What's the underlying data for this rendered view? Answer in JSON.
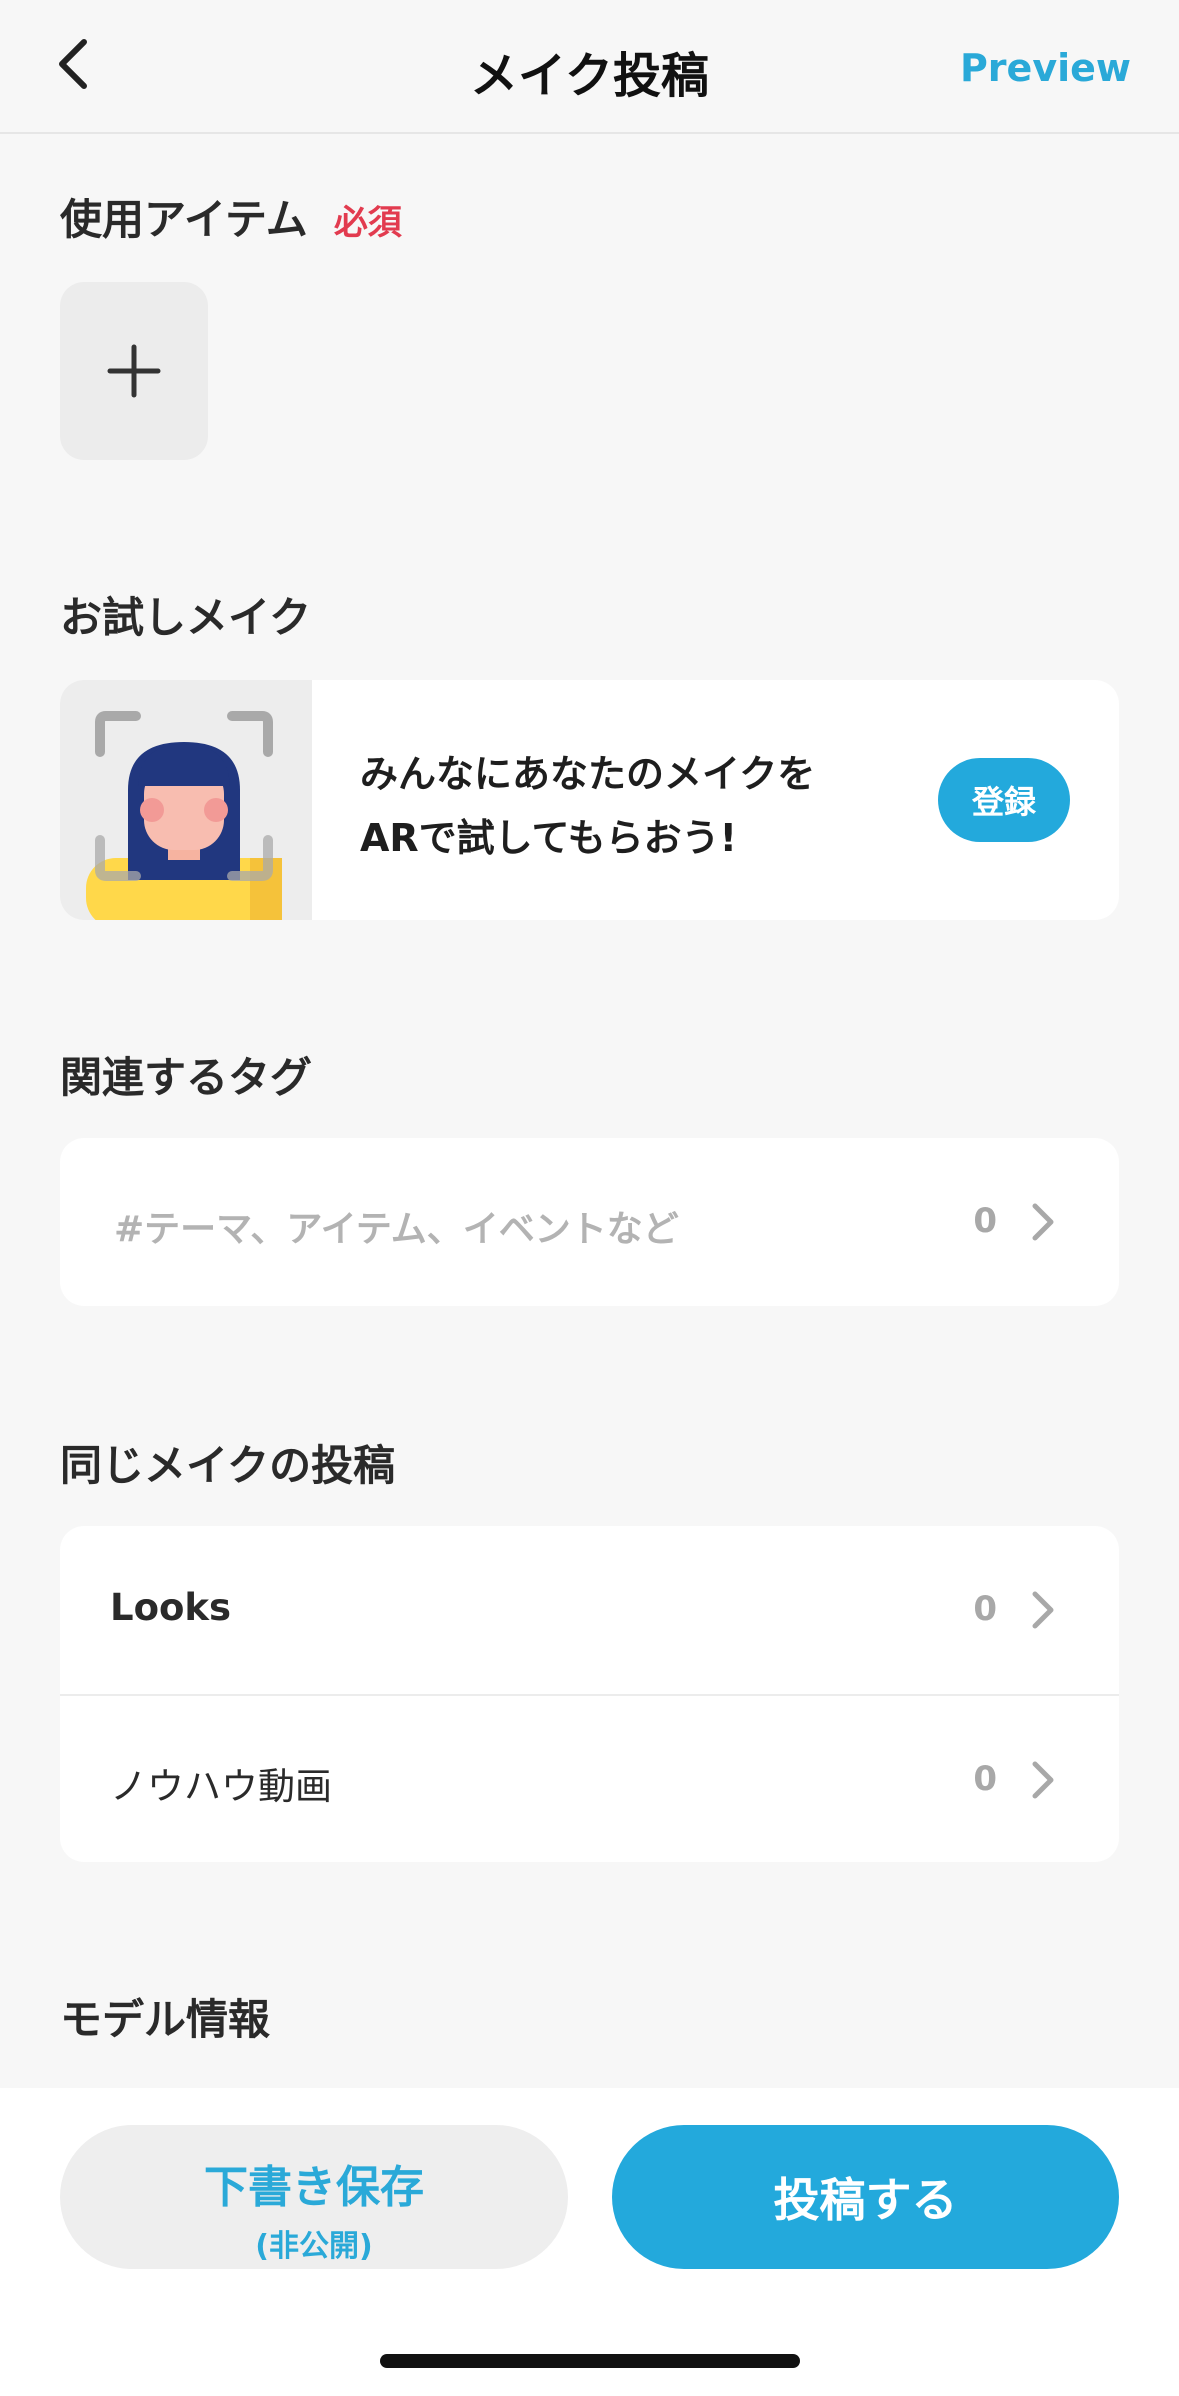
{
  "header": {
    "title": "メイク投稿",
    "preview_label": "Preview"
  },
  "items_section": {
    "title": "使用アイテム",
    "required_label": "必須"
  },
  "try_on_section": {
    "title": "お試しメイク",
    "line1": "みんなにあなたのメイクを",
    "line2": "ARで試してもらおう!",
    "register_label": "登録"
  },
  "tags_section": {
    "title": "関連するタグ",
    "placeholder": "#テーマ、アイテム、イベントなど",
    "count": "0"
  },
  "same_makeup_section": {
    "title": "同じメイクの投稿",
    "rows": [
      {
        "label": "Looks",
        "count": "0"
      },
      {
        "label": "ノウハウ動画",
        "count": "0"
      }
    ]
  },
  "model_section": {
    "title": "モデル情報"
  },
  "footer": {
    "draft_label": "下書き保存",
    "draft_sub": "(非公開)",
    "post_label": "投稿する"
  },
  "colors": {
    "accent": "#23a9dc",
    "required": "#e23b4f"
  }
}
